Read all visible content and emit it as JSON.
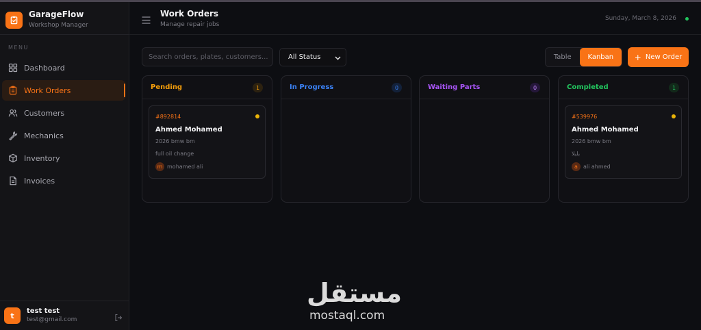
{
  "app": {
    "name": "GarageFlow",
    "subtitle": "Workshop Manager"
  },
  "sidebar": {
    "menu_label": "MENU",
    "items": [
      {
        "label": "Dashboard",
        "icon": "grid-icon"
      },
      {
        "label": "Work Orders",
        "icon": "clipboard-icon",
        "active": true
      },
      {
        "label": "Customers",
        "icon": "users-icon"
      },
      {
        "label": "Mechanics",
        "icon": "wrench-icon"
      },
      {
        "label": "Inventory",
        "icon": "box-icon"
      },
      {
        "label": "Invoices",
        "icon": "file-icon"
      }
    ],
    "user": {
      "initial": "t",
      "name": "test test",
      "email": "test@gmail.com"
    }
  },
  "header": {
    "title": "Work Orders",
    "subtitle": "Manage repair jobs",
    "date": "Sunday, March 8, 2026",
    "status_color": "#22c55e"
  },
  "toolbar": {
    "search_placeholder": "Search orders, plates, customers...",
    "status_filter": "All Status",
    "view_table": "Table",
    "view_kanban": "Kanban",
    "active_view": "Kanban",
    "new_order": "New Order"
  },
  "columns": [
    {
      "title": "Pending",
      "count": "1",
      "color": "#f59e0b",
      "cards": [
        {
          "id": "#892814",
          "customer": "Ahmed Mohamed",
          "vehicle": "2026 bmw bm",
          "note": "full oil change",
          "mechanic_initial": "m",
          "mechanic": "mohamed ali"
        }
      ]
    },
    {
      "title": "In Progress",
      "count": "0",
      "color": "#3b82f6",
      "cards": []
    },
    {
      "title": "Waiting Parts",
      "count": "0",
      "color": "#a855f7",
      "cards": []
    },
    {
      "title": "Completed",
      "count": "1",
      "color": "#22c55e",
      "cards": [
        {
          "id": "#539976",
          "customer": "Ahmed Mohamed",
          "vehicle": "2026 bmw bm",
          "note": "بلبلا",
          "mechanic_initial": "a",
          "mechanic": "ali ahmed"
        }
      ]
    }
  ],
  "watermark": {
    "arabic": "مستقل",
    "latin": "mostaql.com"
  },
  "colors": {
    "accent": "#f97316",
    "background": "#0d0e12",
    "sidebar": "#141417",
    "priority_dot": "#eab308"
  }
}
